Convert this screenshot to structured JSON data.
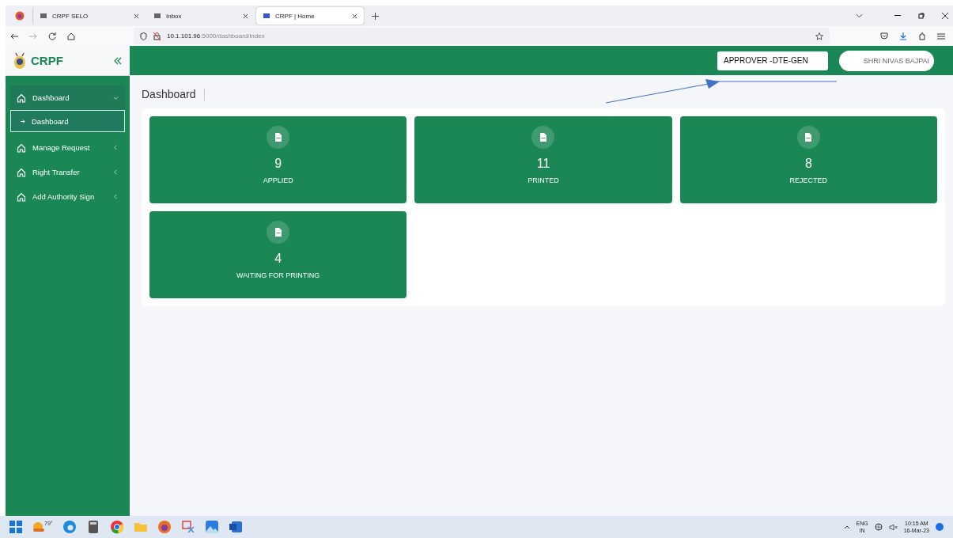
{
  "browser": {
    "tabs": [
      {
        "label": "CRPF SELO",
        "selected": false
      },
      {
        "label": "Inbox",
        "selected": false
      },
      {
        "label": "CRPF | Home",
        "selected": true
      }
    ],
    "address": {
      "host": "10.1.101.96",
      "rest": ":5000/dashboard/index"
    }
  },
  "app": {
    "logo": "CRPF",
    "role": "APPROVER -DTE-GEN",
    "user": "SHRI NIVAS BAJPAI"
  },
  "sidebar": {
    "items": [
      {
        "label": "Dashboard",
        "expanded": true,
        "children": [
          {
            "label": "Dashboard",
            "selected": true
          }
        ]
      },
      {
        "label": "Manage Request",
        "expanded": false
      },
      {
        "label": "Right Transfer",
        "expanded": false
      },
      {
        "label": "Add Authority Sign",
        "expanded": false
      }
    ]
  },
  "page_title": "Dashboard",
  "stats": [
    {
      "value": "9",
      "label": "APPLIED"
    },
    {
      "value": "11",
      "label": "PRINTED"
    },
    {
      "value": "8",
      "label": "REJECTED"
    },
    {
      "value": "4",
      "label": "WAITING FOR PRINTING"
    }
  ],
  "taskbar": {
    "weather": "79°",
    "language": "ENG",
    "region": "IN",
    "time": "10:15 AM",
    "date": "16-Mar-23"
  }
}
